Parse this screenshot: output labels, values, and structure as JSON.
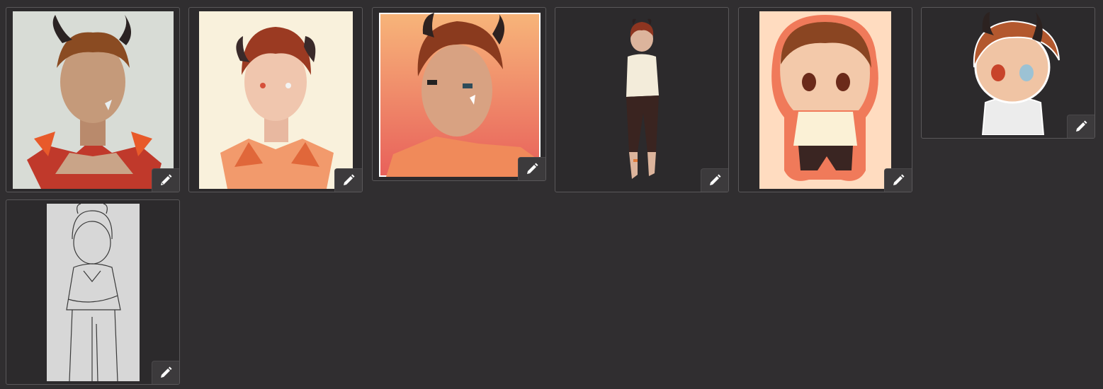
{
  "gallery": {
    "item_count": 7,
    "items": [
      {
        "id": "art-1",
        "style": "painted portrait",
        "edit_action": "edit"
      },
      {
        "id": "art-2",
        "style": "pastel portrait",
        "edit_action": "edit"
      },
      {
        "id": "art-3",
        "style": "pixel portrait",
        "edit_action": "edit"
      },
      {
        "id": "art-4",
        "style": "full body",
        "edit_action": "edit"
      },
      {
        "id": "art-5",
        "style": "chibi sticker",
        "edit_action": "edit"
      },
      {
        "id": "art-6",
        "style": "chibi bust",
        "edit_action": "edit"
      },
      {
        "id": "art-7",
        "style": "lineart sketch",
        "edit_action": "edit"
      }
    ]
  },
  "icons": {
    "edit": "pencil-icon"
  },
  "colors": {
    "page_background": "#302e30",
    "card_border": "#5a585a",
    "edit_button": "#3c3a3c",
    "pencil": "#ffffff"
  }
}
